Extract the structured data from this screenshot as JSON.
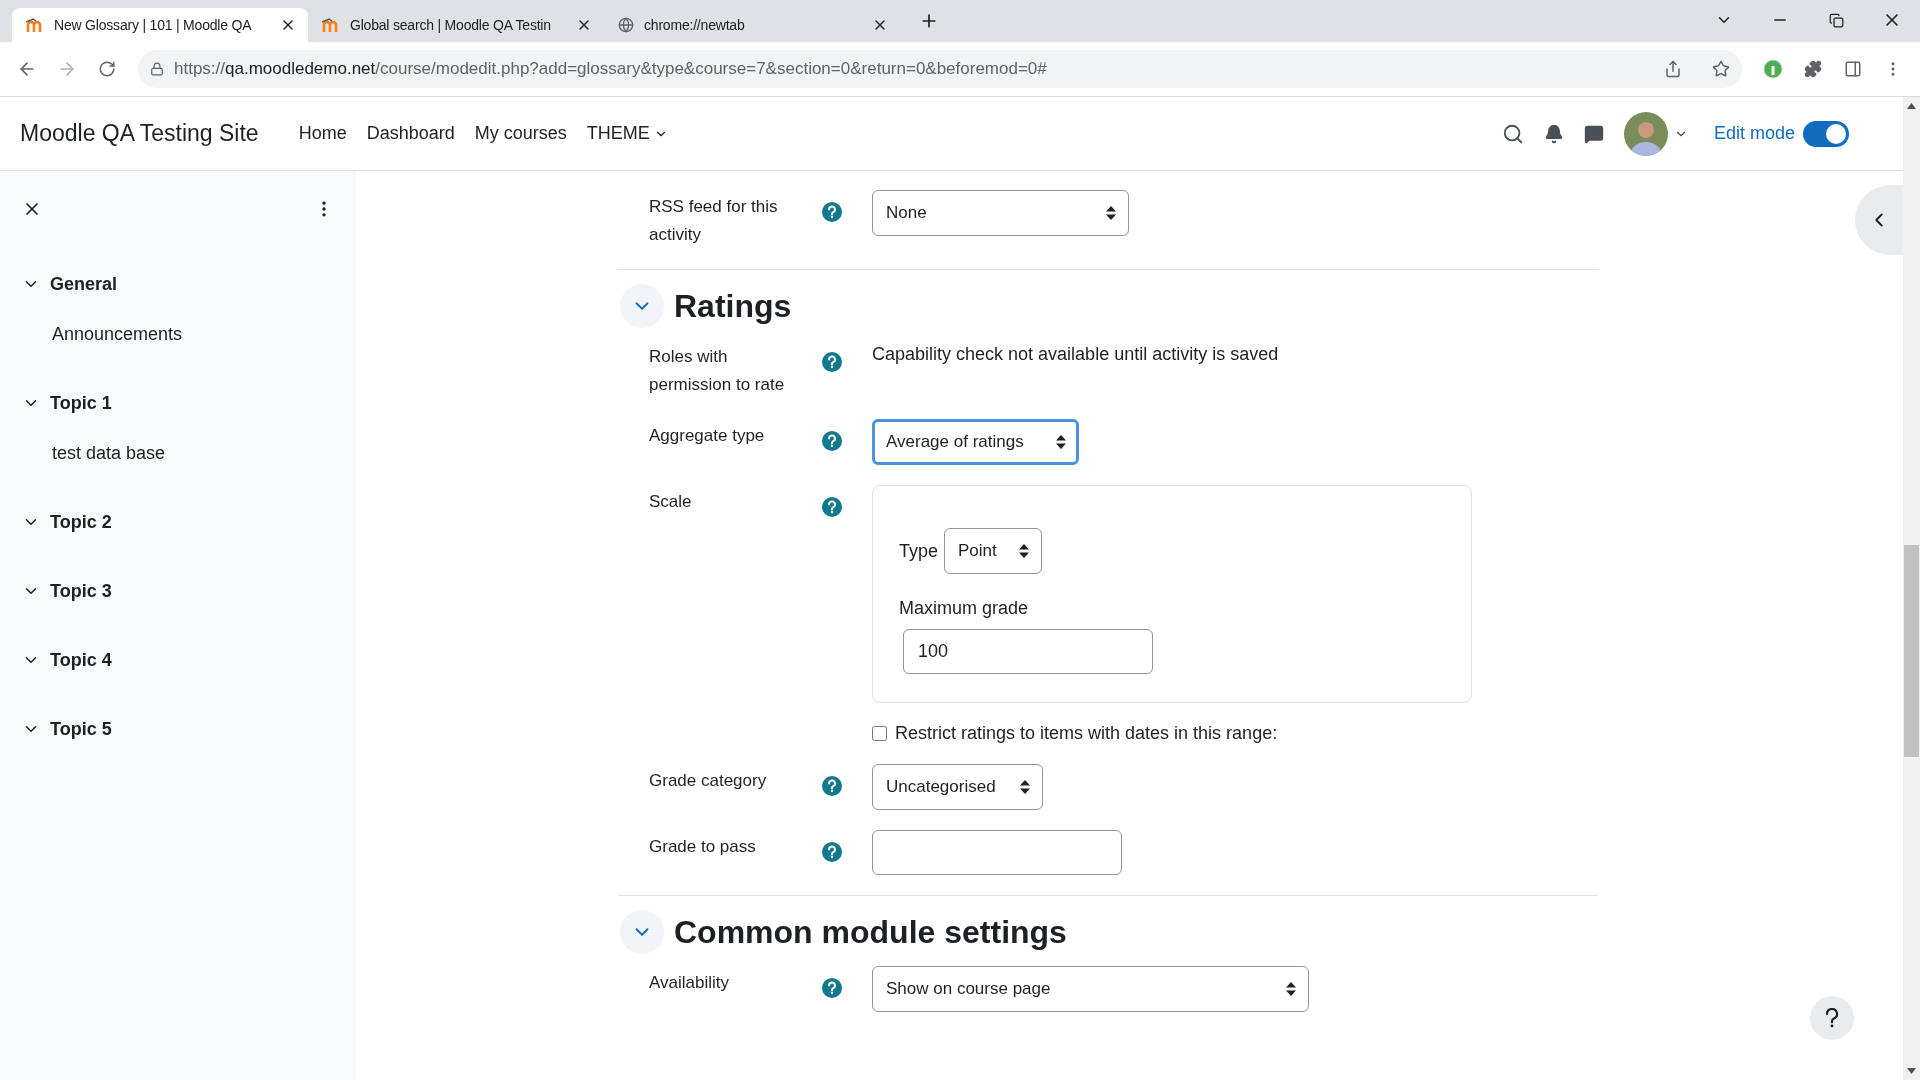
{
  "browser": {
    "tabs": [
      {
        "title": "New Glossary | 101 | Moodle QA",
        "selected": true
      },
      {
        "title": "Global search | Moodle QA Testin",
        "selected": false
      },
      {
        "title": "chrome://newtab",
        "selected": false
      }
    ],
    "url": {
      "scheme": "https://",
      "host": "qa.moodledemo.net",
      "path": "/course/modedit.php?add=glossary&type&course=7&section=0&return=0&beforemod=0#"
    }
  },
  "navbar": {
    "site_name": "Moodle QA Testing Site",
    "links": [
      {
        "label": "Home",
        "dropdown": false
      },
      {
        "label": "Dashboard",
        "dropdown": false
      },
      {
        "label": "My courses",
        "dropdown": false
      },
      {
        "label": "THEME",
        "dropdown": true
      }
    ],
    "edit_mode": {
      "label": "Edit mode",
      "on": true
    }
  },
  "sidebar": {
    "items": [
      {
        "label": "General",
        "expanded": true,
        "children": [
          {
            "label": "Announcements"
          }
        ]
      },
      {
        "label": "Topic 1",
        "expanded": true,
        "children": [
          {
            "label": "test data base"
          }
        ]
      },
      {
        "label": "Topic 2",
        "expanded": true
      },
      {
        "label": "Topic 3",
        "expanded": true
      },
      {
        "label": "Topic 4",
        "expanded": true
      },
      {
        "label": "Topic 5",
        "expanded": true
      }
    ]
  },
  "form": {
    "top_rows": [
      {
        "kind": "select",
        "label": "RSS feed for this activity",
        "value": "None"
      }
    ],
    "sections": [
      {
        "title": "Ratings",
        "expanded": true,
        "rows": [
          {
            "kind": "static",
            "label": "Roles with permission to rate",
            "value": "Capability check not available until activity is saved"
          },
          {
            "kind": "select",
            "label": "Aggregate type",
            "value": "Average of ratings",
            "focused": true
          },
          {
            "kind": "scale",
            "label": "Scale",
            "type_label": "Type",
            "type_value": "Point",
            "max_label": "Maximum grade",
            "max_value": "100"
          },
          {
            "kind": "checkbox",
            "label": "Restrict ratings to items with dates in this range:",
            "checked": false
          },
          {
            "kind": "select",
            "label": "Grade category",
            "value": "Uncategorised",
            "focused": false
          },
          {
            "kind": "text",
            "label": "Grade to pass"
          }
        ]
      },
      {
        "title": "Common module settings",
        "expanded": true,
        "rows": [
          {
            "kind": "select",
            "label": "Availability",
            "value": "Show on course page",
            "focused": false
          }
        ]
      }
    ]
  }
}
